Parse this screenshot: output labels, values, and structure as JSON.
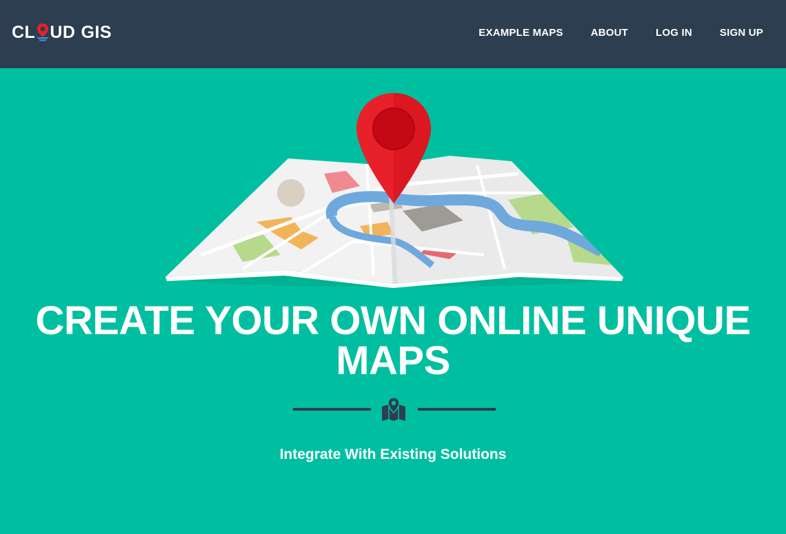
{
  "navbar": {
    "brand_prefix": "CL",
    "brand_suffix": "UD",
    "brand_second": "GIS",
    "links": [
      "EXAMPLE MAPS",
      "ABOUT",
      "LOG IN",
      "SIGN UP"
    ]
  },
  "hero": {
    "headline": "CREATE YOUR OWN ONLINE UNIQUE MAPS",
    "subtitle": "Integrate With Existing Solutions",
    "illustration_icon": "folded-map-with-pin-icon",
    "divider_icon": "map-marker-icon"
  },
  "colors": {
    "navbar_bg": "#2C3E50",
    "hero_bg": "#00BFA0",
    "pin_red": "#E8202A",
    "river_blue": "#6FA8DC",
    "text": "#FFFFFF"
  }
}
